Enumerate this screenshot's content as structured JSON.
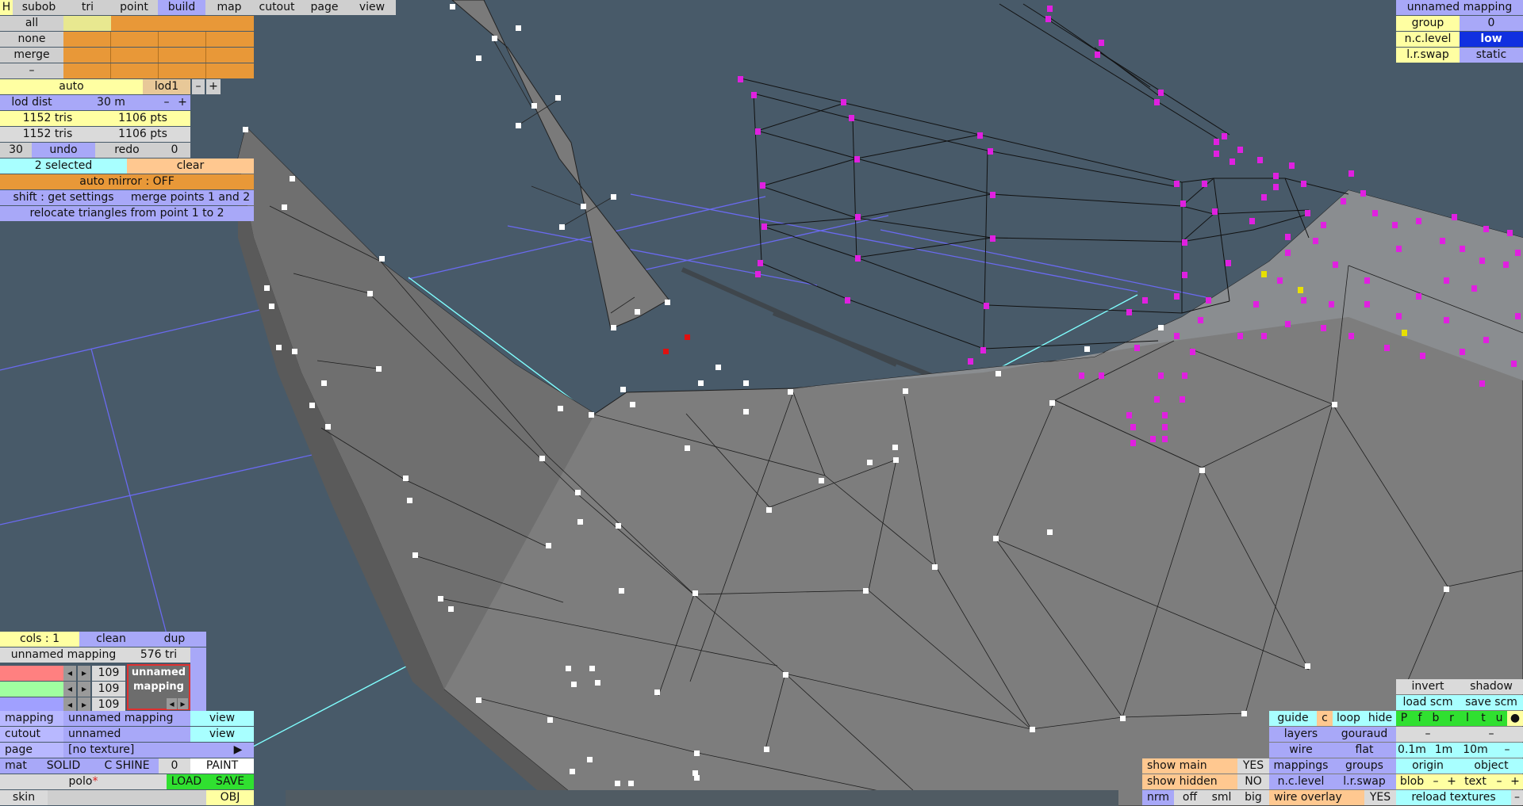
{
  "colors": {
    "background": "#485a69",
    "surface": "#7c7c7c",
    "selected_vertex": "#e020e0",
    "white_vertex": "#ffffff",
    "accent_blue": "#6a6af0",
    "accent_cyan": "#80ffff"
  },
  "menu": {
    "h": "H",
    "tabs": [
      "subob",
      "tri",
      "point",
      "build",
      "map",
      "cutout",
      "page",
      "view"
    ],
    "active": "build"
  },
  "selection": {
    "all": "all",
    "none": "none",
    "merge": "merge",
    "dash": "–"
  },
  "lod": {
    "auto": "auto",
    "level": "lod1",
    "minus": "–",
    "plus": "+",
    "dist_label": "lod dist",
    "dist_value": "30 m"
  },
  "stats": {
    "row1_tris": "1152 tris",
    "row1_pts": "1106 pts",
    "row2_tris": "1152 tris",
    "row2_pts": "1106 pts"
  },
  "history": {
    "count": "30",
    "undo": "undo",
    "redo": "redo",
    "redo_count": "0"
  },
  "tools": {
    "selected": "2 selected",
    "clear": "clear",
    "auto_mirror": "auto mirror : OFF",
    "get_settings": "shift : get settings",
    "merge_points": "merge points 1 and 2",
    "relocate": "relocate triangles from point 1 to 2"
  },
  "mapping_panel": {
    "title": "unnamed mapping",
    "group_label": "group",
    "group_value": "0",
    "nc_label": "n.c.level",
    "nc_value": "low",
    "lr_label": "l.r.swap",
    "lr_value": "static"
  },
  "colors_panel": {
    "cols": "cols : 1",
    "clean": "clean",
    "dup": "dup",
    "mapping_name": "unnamed mapping",
    "tri_count": "576 tri",
    "r": "109",
    "g": "109",
    "b": "109",
    "preview_line1": "unnamed",
    "preview_line2": "mapping"
  },
  "props": {
    "mapping_label": "mapping",
    "mapping_value": "unnamed mapping",
    "cutout_label": "cutout",
    "cutout_value": "unnamed",
    "page_label": "page",
    "page_value": "[no texture]",
    "view": "view",
    "mat": "mat",
    "solid": "SOLID",
    "cshine": "C SHINE",
    "zero": "0",
    "paint": "PAINT",
    "name": "polo",
    "load": "LOAD",
    "save": "SAVE",
    "skin": "skin",
    "obj": "OBJ"
  },
  "view_panel": {
    "invert": "invert",
    "shadow": "shadow",
    "load_scm": "load scm",
    "save_scm": "save scm",
    "guide": "guide",
    "c": "c",
    "loop": "loop",
    "hide": "hide",
    "axes": [
      "P",
      "f",
      "b",
      "r",
      "l",
      "t",
      "u"
    ],
    "dot": "●",
    "layers": "layers",
    "gouraud": "gouraud",
    "dash1": "–",
    "dash2": "–",
    "wire": "wire",
    "flat": "flat",
    "d01": "0.1m",
    "d1": "1m",
    "d10": "10m",
    "dminus": "–",
    "show_main": "show main",
    "show_main_v": "YES",
    "show_hidden": "show hidden",
    "show_hidden_v": "NO",
    "mappings": "mappings",
    "groups": "groups",
    "origin": "origin",
    "object": "object",
    "nclevel": "n.c.level",
    "lrswap": "l.r.swap",
    "blob": "blob",
    "bm": "–",
    "bp": "+",
    "text": "text",
    "tm": "–",
    "tp": "+",
    "nrm": "nrm",
    "off": "off",
    "sml": "sml",
    "big": "big",
    "wire_overlay": "wire overlay",
    "wire_overlay_v": "YES",
    "reload": "reload textures",
    "rm": "–"
  }
}
